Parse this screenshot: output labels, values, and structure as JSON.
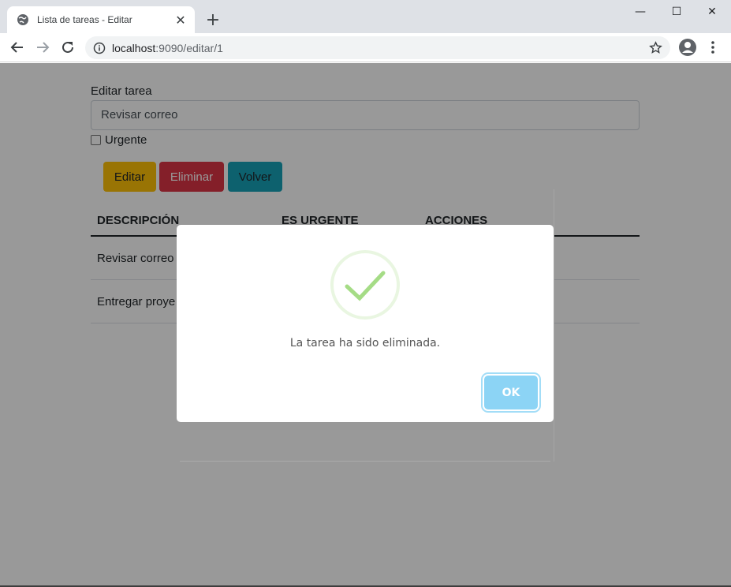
{
  "browser": {
    "tab_title": "Lista de tareas - Editar",
    "new_tab_label": "+",
    "url_host": "localhost",
    "url_rest": ":9090/editar/1",
    "window_controls": {
      "minimize": "—",
      "maximize": "☐",
      "close": "✕"
    },
    "icons": [
      "globe-icon",
      "close-icon",
      "back-icon",
      "forward-icon",
      "reload-icon",
      "info-icon",
      "star-icon",
      "profile-icon",
      "menu-icon"
    ]
  },
  "form": {
    "label": "Editar tarea",
    "input_value": "Revisar correo",
    "checkbox_label": "Urgente",
    "checkbox_checked": false
  },
  "buttons": {
    "editar": "Editar",
    "eliminar": "Eliminar",
    "volver": "Volver"
  },
  "table": {
    "headers": [
      "DESCRIPCIÓN",
      "ES URGENTE",
      "ACCIONES"
    ],
    "rows": [
      {
        "descripcion": "Revisar correo",
        "urgente": "",
        "acciones": ""
      },
      {
        "descripcion": "Entregar proye",
        "urgente": "",
        "acciones": ""
      }
    ]
  },
  "modal": {
    "message": "La tarea ha sido eliminada.",
    "ok_label": "OK",
    "icon": "success-check-icon"
  },
  "colors": {
    "editar": "#ffc107",
    "eliminar": "#dc3545",
    "volver": "#17a2b8",
    "ok_button": "#8cd4f5",
    "success": "#a5dc86"
  }
}
